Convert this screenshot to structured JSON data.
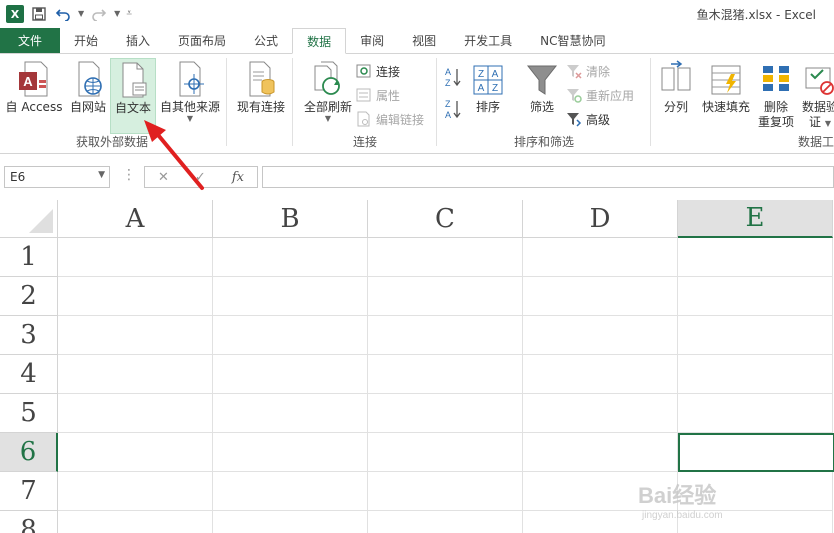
{
  "window": {
    "title": "鱼木混猪.xlsx - Excel"
  },
  "qat": {
    "logo_letter": "X"
  },
  "tabs": [
    {
      "label": "文件",
      "kind": "file"
    },
    {
      "label": "开始"
    },
    {
      "label": "插入"
    },
    {
      "label": "页面布局"
    },
    {
      "label": "公式"
    },
    {
      "label": "数据",
      "active": true
    },
    {
      "label": "审阅"
    },
    {
      "label": "视图"
    },
    {
      "label": "开发工具"
    },
    {
      "label": "NC智慧协同"
    }
  ],
  "ribbon": {
    "get_external": {
      "label": "获取外部数据",
      "access": "自 Access",
      "web": "自网站",
      "text": "自文本",
      "other": "自其他来源"
    },
    "existing": {
      "label": "现有连接"
    },
    "connections": {
      "label": "连接",
      "refresh_all": "全部刷新",
      "connections": "连接",
      "properties": "属性",
      "edit_links": "编辑链接"
    },
    "sort_filter": {
      "label": "排序和筛选",
      "sort": "排序",
      "filter": "筛选",
      "clear": "清除",
      "reapply": "重新应用",
      "advanced": "高级"
    },
    "data_tools": {
      "label": "数据工",
      "split": "分列",
      "flash_fill": "快速填充",
      "remove_dup_1": "删除",
      "remove_dup_2": "重复项",
      "validate_1": "数据验",
      "validate_2": "证"
    }
  },
  "formula_bar": {
    "name_box": "E6",
    "fx": "fx",
    "cancel": "✕",
    "confirm": "✓",
    "value": ""
  },
  "sheet": {
    "columns": [
      "A",
      "B",
      "C",
      "D",
      "E"
    ],
    "rows": [
      "1",
      "2",
      "3",
      "4",
      "5",
      "6",
      "7",
      "8"
    ],
    "active_cell": "E6"
  },
  "watermark": {
    "text": "Bai经验",
    "url_text": "jingyan.baidu.com"
  },
  "colors": {
    "excel_green": "#217346",
    "arrow_red": "#e02020",
    "highlight": "#d6efdf"
  }
}
